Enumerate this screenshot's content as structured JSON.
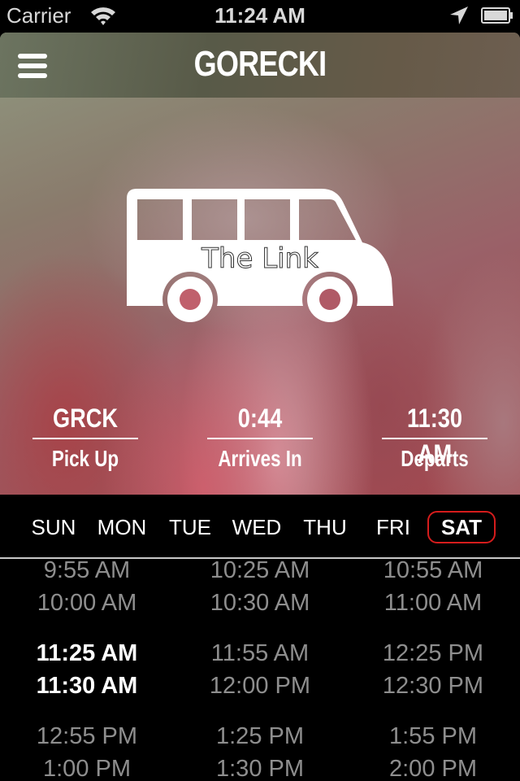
{
  "status_bar": {
    "carrier": "Carrier",
    "time": "11:24 AM",
    "icons": [
      "wifi-icon",
      "location-arrow-icon",
      "battery-icon"
    ]
  },
  "nav": {
    "title": "GORECKI",
    "menu_icon": "hamburger-menu-icon"
  },
  "hero": {
    "bus_icon": "bus-icon",
    "bus_label": "The Link",
    "pickup": {
      "value": "GRCK",
      "label": "Pick Up"
    },
    "arrives": {
      "value": "0:44",
      "label": "Arrives In"
    },
    "departs": {
      "value": "11:30 AM",
      "label": "Departs"
    }
  },
  "days": {
    "items": [
      "SUN",
      "MON",
      "TUE",
      "WED",
      "THU",
      "FRI",
      "SAT"
    ],
    "selected": "SAT",
    "selected_color": "#d51c1c"
  },
  "schedule": {
    "rows": [
      [
        "9:55 AM",
        "10:25 AM",
        "10:55 AM"
      ],
      [
        "10:00 AM",
        "10:30 AM",
        "11:00 AM"
      ],
      [
        "11:25 AM",
        "11:55 AM",
        "12:25 PM"
      ],
      [
        "11:30 AM",
        "12:00 PM",
        "12:30 PM"
      ],
      [
        "12:55 PM",
        "1:25 PM",
        "1:55 PM"
      ],
      [
        "1:00 PM",
        "1:30 PM",
        "2:00 PM"
      ]
    ],
    "highlighted": [
      "11:25 AM",
      "11:30 AM"
    ],
    "text_color": "#8e8e8e",
    "highlight_color": "#ffffff"
  }
}
